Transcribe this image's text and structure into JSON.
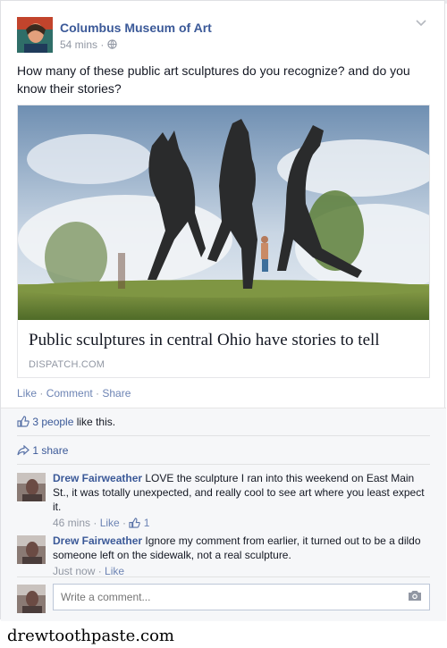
{
  "post": {
    "page_name": "Columbus Museum of Art",
    "time": "54 mins",
    "separator": "·",
    "privacy_icon": "globe-icon",
    "text": "How many of these public art sculptures do you recognize? and do you know their stories?"
  },
  "link": {
    "title": "Public sculptures in central Ohio have stories to tell",
    "domain": "DISPATCH.COM"
  },
  "actions": {
    "like": "Like",
    "comment": "Comment",
    "share": "Share",
    "sep": " · "
  },
  "ufi": {
    "likes_count": "3 people",
    "likes_suffix": " like this.",
    "shares": "1 share"
  },
  "comments": [
    {
      "author": "Drew Fairweather",
      "text": " LOVE the sculpture I ran into this weekend on East Main St., it was totally unexpected, and really cool to see art where you least expect it.",
      "time": "46 mins",
      "like": "Like",
      "like_count": "1"
    },
    {
      "author": "Drew Fairweather",
      "text": " Ignore my comment from earlier, it turned out to be a dildo someone left on the sidewalk, not a real sculpture.",
      "time": "Just now",
      "like": "Like"
    }
  ],
  "composer": {
    "placeholder": "Write a comment..."
  },
  "watermark": "drewtoothpaste.com",
  "colors": {
    "link_blue": "#3b5998",
    "action_blue": "#6d84b4",
    "meta_gray": "#9197a3",
    "ufi_bg": "#f6f7f9"
  }
}
